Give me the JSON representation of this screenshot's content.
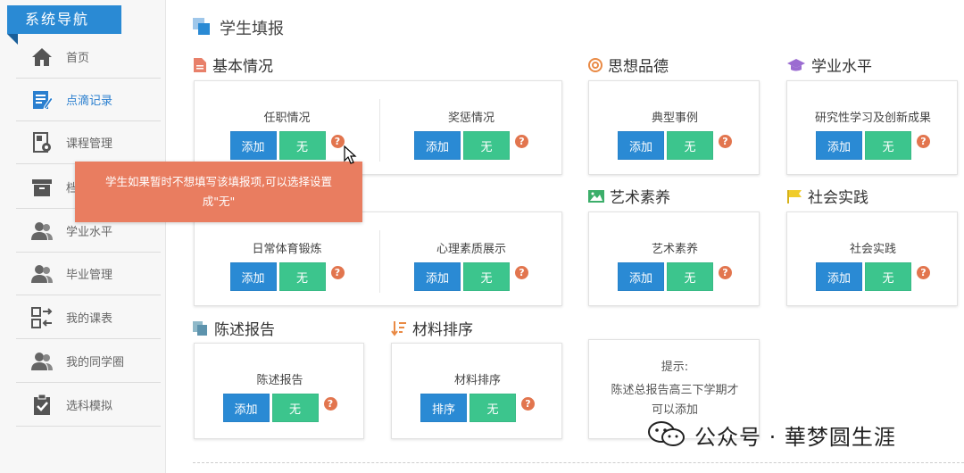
{
  "sidebar": {
    "header": "系统导航",
    "items": [
      {
        "label": "首页",
        "icon": "home-icon"
      },
      {
        "label": "点滴记录",
        "icon": "edit-icon",
        "active": true
      },
      {
        "label": "课程管理",
        "icon": "course-icon"
      },
      {
        "label": "档",
        "icon": "archive-icon"
      },
      {
        "label": "学业水平",
        "icon": "users-icon"
      },
      {
        "label": "毕业管理",
        "icon": "users-icon"
      },
      {
        "label": "我的课表",
        "icon": "schedule-icon"
      },
      {
        "label": "我的同学圈",
        "icon": "users-icon"
      },
      {
        "label": "选科模拟",
        "icon": "checklist-icon"
      }
    ]
  },
  "page": {
    "title": "学生填报"
  },
  "buttons": {
    "add": "添加",
    "none": "无",
    "sort": "排序",
    "help": "?"
  },
  "sections": {
    "basic": {
      "title": "基本情况",
      "row1": [
        "任职情况",
        "奖惩情况"
      ],
      "row2": [
        "日常体育锻炼",
        "心理素质展示"
      ]
    },
    "moral": {
      "title": "思想品德",
      "items": [
        "典型事例"
      ]
    },
    "academic": {
      "title": "学业水平",
      "items": [
        "研究性学习及创新成果"
      ]
    },
    "art": {
      "title": "艺术素养",
      "items": [
        "艺术素养"
      ]
    },
    "social": {
      "title": "社会实践",
      "items": [
        "社会实践"
      ]
    },
    "report": {
      "title": "陈述报告",
      "items": [
        "陈述报告"
      ]
    },
    "materials": {
      "title": "材料排序",
      "items": [
        "材料排序"
      ]
    }
  },
  "tip": {
    "title": "提示:",
    "line1": "陈述总报告高三下学期才",
    "line2": "可以添加"
  },
  "tooltip": {
    "line1": "学生如果暂时不想填写该填报项,可以选择设置",
    "line2": "成\"无\""
  },
  "watermark": {
    "text": "公众号 · 華梦圆生涯",
    "icon": "wechat-icon"
  },
  "colors": {
    "primary": "#2a8ad4",
    "green": "#3cc58d",
    "help": "#e2754e",
    "tooltip": "#e97d60"
  }
}
